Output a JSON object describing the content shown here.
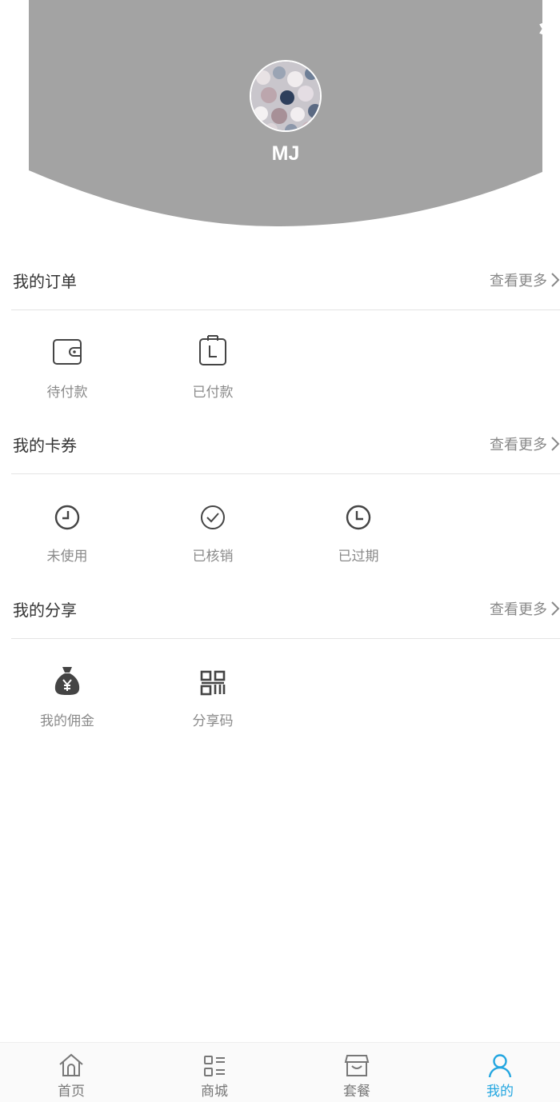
{
  "profile": {
    "name": "MJ"
  },
  "colors": {
    "header_bg": "#a3a3a3",
    "accent": "#23a6e0",
    "text": "#333333",
    "muted": "#8a8a8a"
  },
  "orders": {
    "title": "我的订单",
    "more": "查看更多",
    "items": [
      {
        "label": "待付款",
        "icon": "wallet-icon"
      },
      {
        "label": "已付款",
        "icon": "paid-clipboard-icon"
      }
    ]
  },
  "coupons": {
    "title": "我的卡券",
    "more": "查看更多",
    "items": [
      {
        "label": "未使用",
        "icon": "clock-icon"
      },
      {
        "label": "已核销",
        "icon": "check-circle-icon"
      },
      {
        "label": "已过期",
        "icon": "expired-clock-icon"
      }
    ]
  },
  "share": {
    "title": "我的分享",
    "more": "查看更多",
    "items": [
      {
        "label": "我的佣金",
        "icon": "money-bag-icon"
      },
      {
        "label": "分享码",
        "icon": "qr-code-icon"
      }
    ]
  },
  "tabbar": {
    "items": [
      {
        "label": "首页",
        "icon": "home-icon"
      },
      {
        "label": "商城",
        "icon": "mall-icon"
      },
      {
        "label": "套餐",
        "icon": "package-icon"
      },
      {
        "label": "我的",
        "icon": "user-icon",
        "active": true
      }
    ]
  }
}
